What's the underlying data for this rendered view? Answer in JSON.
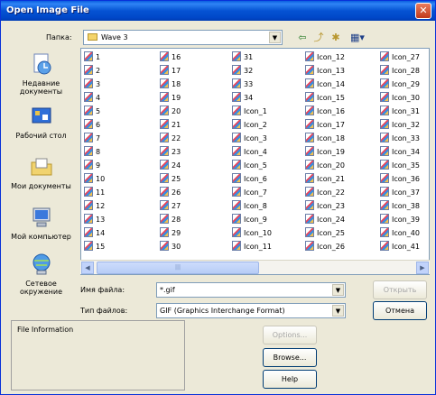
{
  "window": {
    "title": "Open Image File",
    "close_icon": "close-icon"
  },
  "lookin": {
    "label": "Папка:",
    "value": "Wave 3"
  },
  "toolbar": {
    "icons": [
      "back-icon",
      "up-folder-icon",
      "new-folder-icon",
      "view-menu-icon"
    ]
  },
  "places": [
    {
      "icon": "recent-docs-icon",
      "label": "Недавние документы"
    },
    {
      "icon": "desktop-icon",
      "label": "Рабочий стол"
    },
    {
      "icon": "my-documents-icon",
      "label": "Мои документы"
    },
    {
      "icon": "my-computer-icon",
      "label": "Мой компьютер"
    },
    {
      "icon": "network-icon",
      "label": "Сетевое окружение"
    }
  ],
  "files": [
    [
      "1",
      "2",
      "3",
      "4",
      "5",
      "6",
      "7",
      "8",
      "9",
      "10",
      "11",
      "12",
      "13",
      "14",
      "15"
    ],
    [
      "16",
      "17",
      "18",
      "19",
      "20",
      "21",
      "22",
      "23",
      "24",
      "25",
      "26",
      "27",
      "28",
      "29",
      "30"
    ],
    [
      "31",
      "32",
      "33",
      "34",
      "Icon_1",
      "Icon_2",
      "Icon_3",
      "Icon_4",
      "Icon_5",
      "Icon_6",
      "Icon_7",
      "Icon_8",
      "Icon_9",
      "Icon_10",
      "Icon_11"
    ],
    [
      "Icon_12",
      "Icon_13",
      "Icon_14",
      "Icon_15",
      "Icon_16",
      "Icon_17",
      "Icon_18",
      "Icon_19",
      "Icon_20",
      "Icon_21",
      "Icon_22",
      "Icon_23",
      "Icon_24",
      "Icon_25",
      "Icon_26"
    ],
    [
      "Icon_27",
      "Icon_28",
      "Icon_29",
      "Icon_30",
      "Icon_31",
      "Icon_32",
      "Icon_33",
      "Icon_34",
      "Icon_35",
      "Icon_36",
      "Icon_37",
      "Icon_38",
      "Icon_39",
      "Icon_40",
      "Icon_41"
    ]
  ],
  "filename": {
    "label": "Имя файла:",
    "value": "*.gif"
  },
  "filetype": {
    "label": "Тип файлов:",
    "value": "GIF (Graphics Interchange Format)"
  },
  "buttons": {
    "open": "Открыть",
    "cancel": "Отмена",
    "options": "Options...",
    "browse": "Browse...",
    "help": "Help"
  },
  "info": {
    "title": "File Information"
  }
}
